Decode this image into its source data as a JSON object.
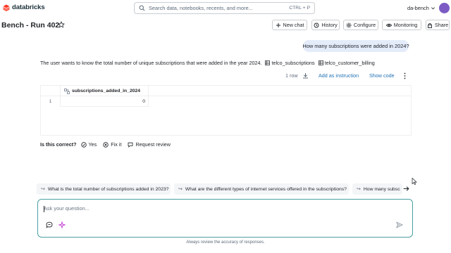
{
  "app": {
    "name": "databricks",
    "brand_color": "#ff3621"
  },
  "search": {
    "placeholder": "Search data, notebooks, recents, and more...",
    "shortcut": "CTRL + P"
  },
  "workspace": {
    "name": "da-bench"
  },
  "page": {
    "title": "Bench - Run 402"
  },
  "toolbar": {
    "new_chat": "New chat",
    "history": "History",
    "configure": "Configure",
    "monitoring": "Monitoring",
    "share": "Share"
  },
  "chat": {
    "user_message": "How many subscriptions were added in 2024?",
    "answer_text": "The user wants to know the total number of unique subscriptions that were added in the year 2024.",
    "tables": [
      "telco_subscriptions",
      "telco_customer_billing"
    ],
    "result": {
      "row_count": "1 row",
      "add_instruction": "Add as instruction",
      "show_code": "Show code",
      "columns": [
        "subscriptions_added_in_2024"
      ],
      "rows": [
        {
          "index": "1",
          "values": [
            "0"
          ]
        }
      ]
    },
    "feedback": {
      "label": "Is this correct?",
      "yes": "Yes",
      "fix": "Fix it",
      "review": "Request review"
    }
  },
  "suggestions": [
    "What is the total number of subscriptions added in 2023?",
    "What are the different types of internet services offered in the subscriptions?",
    "How many subsc"
  ],
  "composer": {
    "placeholder": "Ask your question...",
    "value": ""
  },
  "disclaimer": "Always review the accuracy of responses.",
  "colors": {
    "accent_link": "#2272b4",
    "user_bubble": "#e4ecfa",
    "input_border": "#4a9fa1"
  }
}
